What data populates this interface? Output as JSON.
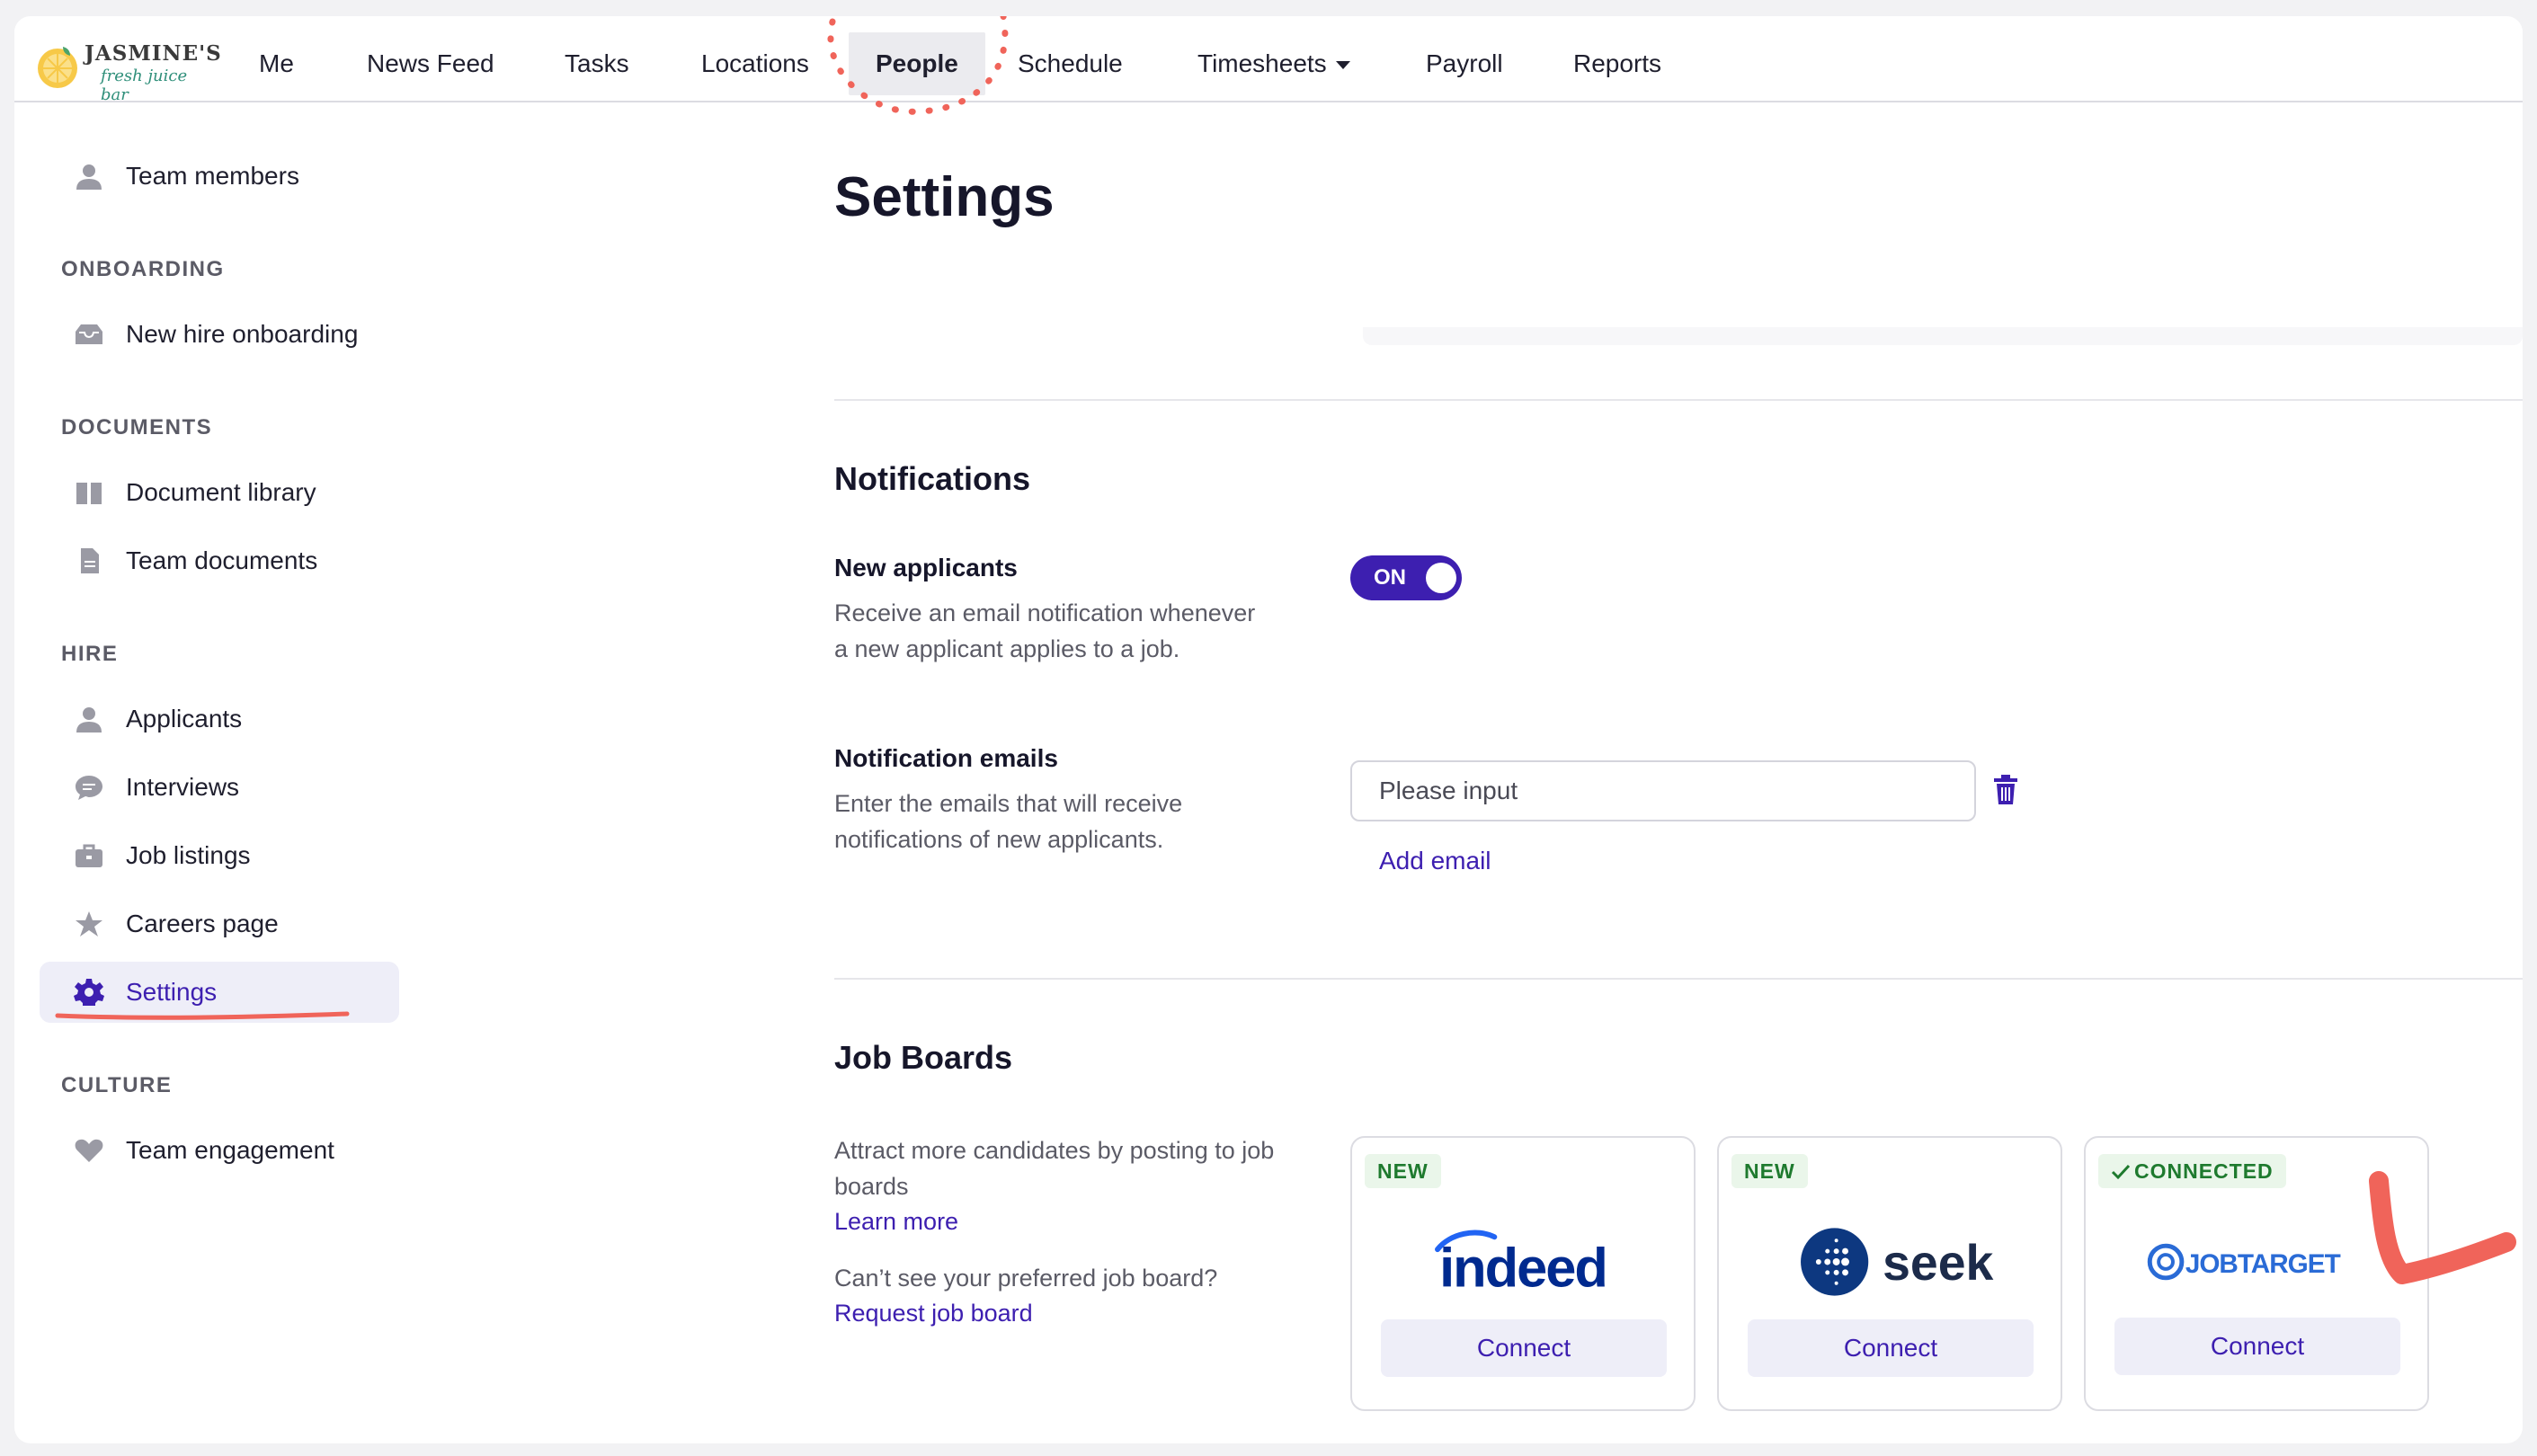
{
  "brand": {
    "name": "JASMINE'S",
    "tagline": "fresh juice bar"
  },
  "nav": {
    "items": [
      {
        "label": "Me"
      },
      {
        "label": "News Feed"
      },
      {
        "label": "Tasks"
      },
      {
        "label": "Locations"
      },
      {
        "label": "People",
        "active": true
      },
      {
        "label": "Schedule"
      },
      {
        "label": "Timesheets"
      },
      {
        "label": "Payroll"
      },
      {
        "label": "Reports"
      }
    ]
  },
  "sidebar": {
    "team_members": "Team members",
    "onboarding_heading": "ONBOARDING",
    "new_hire_onboarding": "New hire onboarding",
    "documents_heading": "DOCUMENTS",
    "document_library": "Document library",
    "team_documents": "Team documents",
    "hire_heading": "HIRE",
    "applicants": "Applicants",
    "interviews": "Interviews",
    "job_listings": "Job listings",
    "careers_page": "Careers page",
    "settings": "Settings",
    "culture_heading": "CULTURE",
    "team_engagement": "Team engagement"
  },
  "main": {
    "title": "Settings",
    "notifications": {
      "heading": "Notifications",
      "new_applicants_label": "New applicants",
      "new_applicants_desc": "Receive an email notification whenever a new applicant applies to a job.",
      "toggle_label": "ON",
      "emails_label": "Notification emails",
      "emails_desc": "Enter the emails that will receive notifications of new applicants.",
      "input_placeholder": "Please input",
      "add_email": "Add email"
    },
    "job_boards": {
      "heading": "Job Boards",
      "desc": "Attract more candidates by posting to job boards",
      "learn_more": "Learn more",
      "cant_see": "Can’t see your preferred job board?",
      "request": "Request job board",
      "cards": [
        {
          "badge": "NEW",
          "brand": "indeed",
          "button": "Connect"
        },
        {
          "badge": "NEW",
          "brand": "seek",
          "button": "Connect"
        },
        {
          "badge": "CONNECTED",
          "brand": "JOBTARGET",
          "button": "Connect"
        }
      ]
    }
  },
  "colors": {
    "accent": "#3d1fb0",
    "annotation": "#f0645a",
    "connected_green": "#1e7a2e"
  }
}
